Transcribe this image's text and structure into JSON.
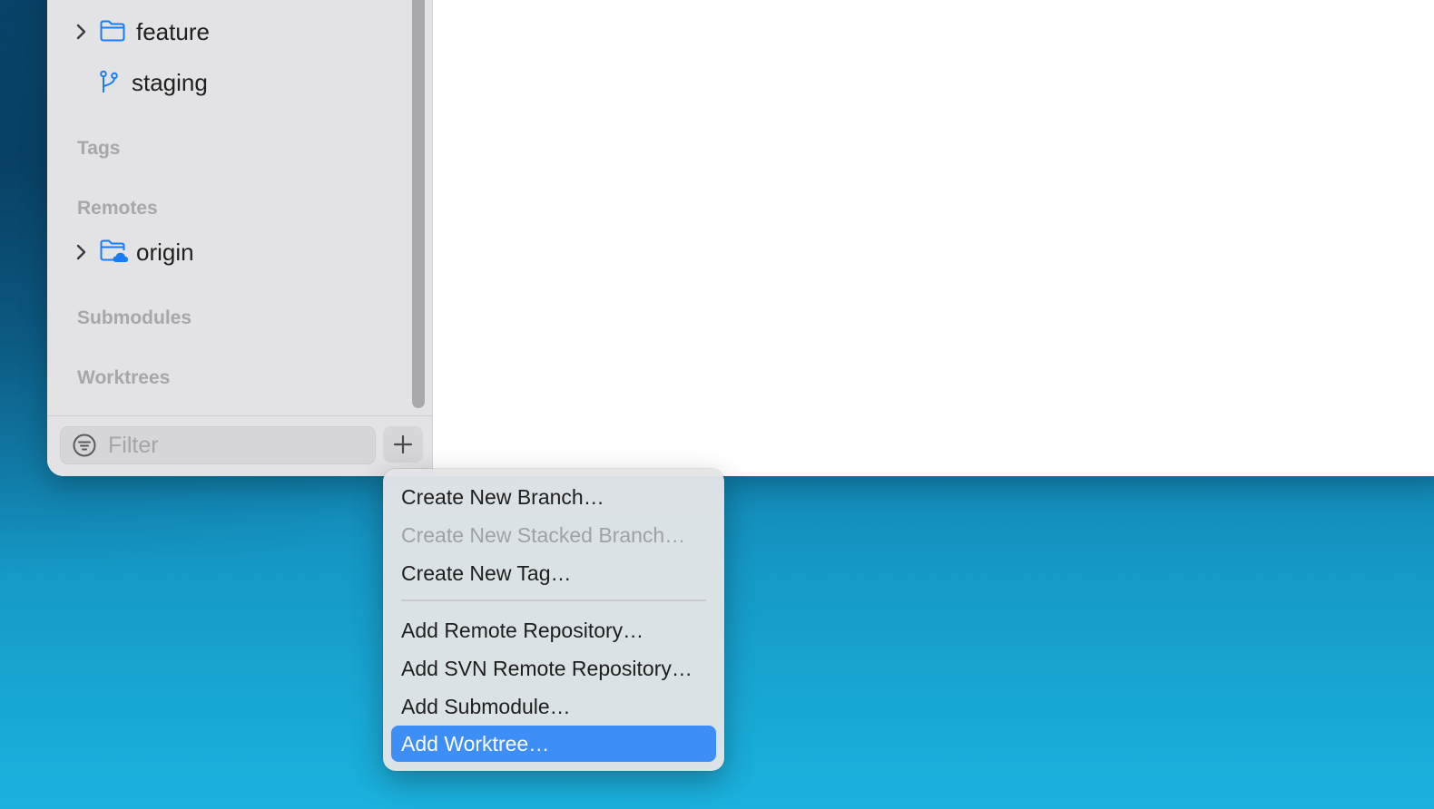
{
  "sidebar": {
    "branches": [
      {
        "label": "feature",
        "icon": "folder-icon",
        "expandable": true
      },
      {
        "label": "staging",
        "icon": "branch-icon",
        "expandable": false
      }
    ],
    "sections": {
      "tags": "Tags",
      "remotes": "Remotes",
      "submodules": "Submodules",
      "worktrees": "Worktrees"
    },
    "remotes": [
      {
        "label": "origin",
        "icon": "cloud-folder-icon",
        "expandable": true
      }
    ],
    "filter": {
      "placeholder": "Filter",
      "value": ""
    },
    "add_button_icon": "plus-icon"
  },
  "menu": {
    "items": [
      {
        "label": "Create New Branch…",
        "enabled": true
      },
      {
        "label": "Create New Stacked Branch…",
        "enabled": false
      },
      {
        "label": "Create New Tag…",
        "enabled": true
      },
      {
        "label": "Add Remote Repository…",
        "enabled": true
      },
      {
        "label": "Add SVN Remote Repository…",
        "enabled": true
      },
      {
        "label": "Add Submodule…",
        "enabled": true
      },
      {
        "label": "Add Worktree…",
        "enabled": true,
        "selected": true
      }
    ]
  },
  "colors": {
    "accent": "#3d8ff7",
    "icon_blue": "#1a7cf5",
    "sidebar_bg": "#e3e3e6",
    "section_header": "#a7a7ab"
  }
}
